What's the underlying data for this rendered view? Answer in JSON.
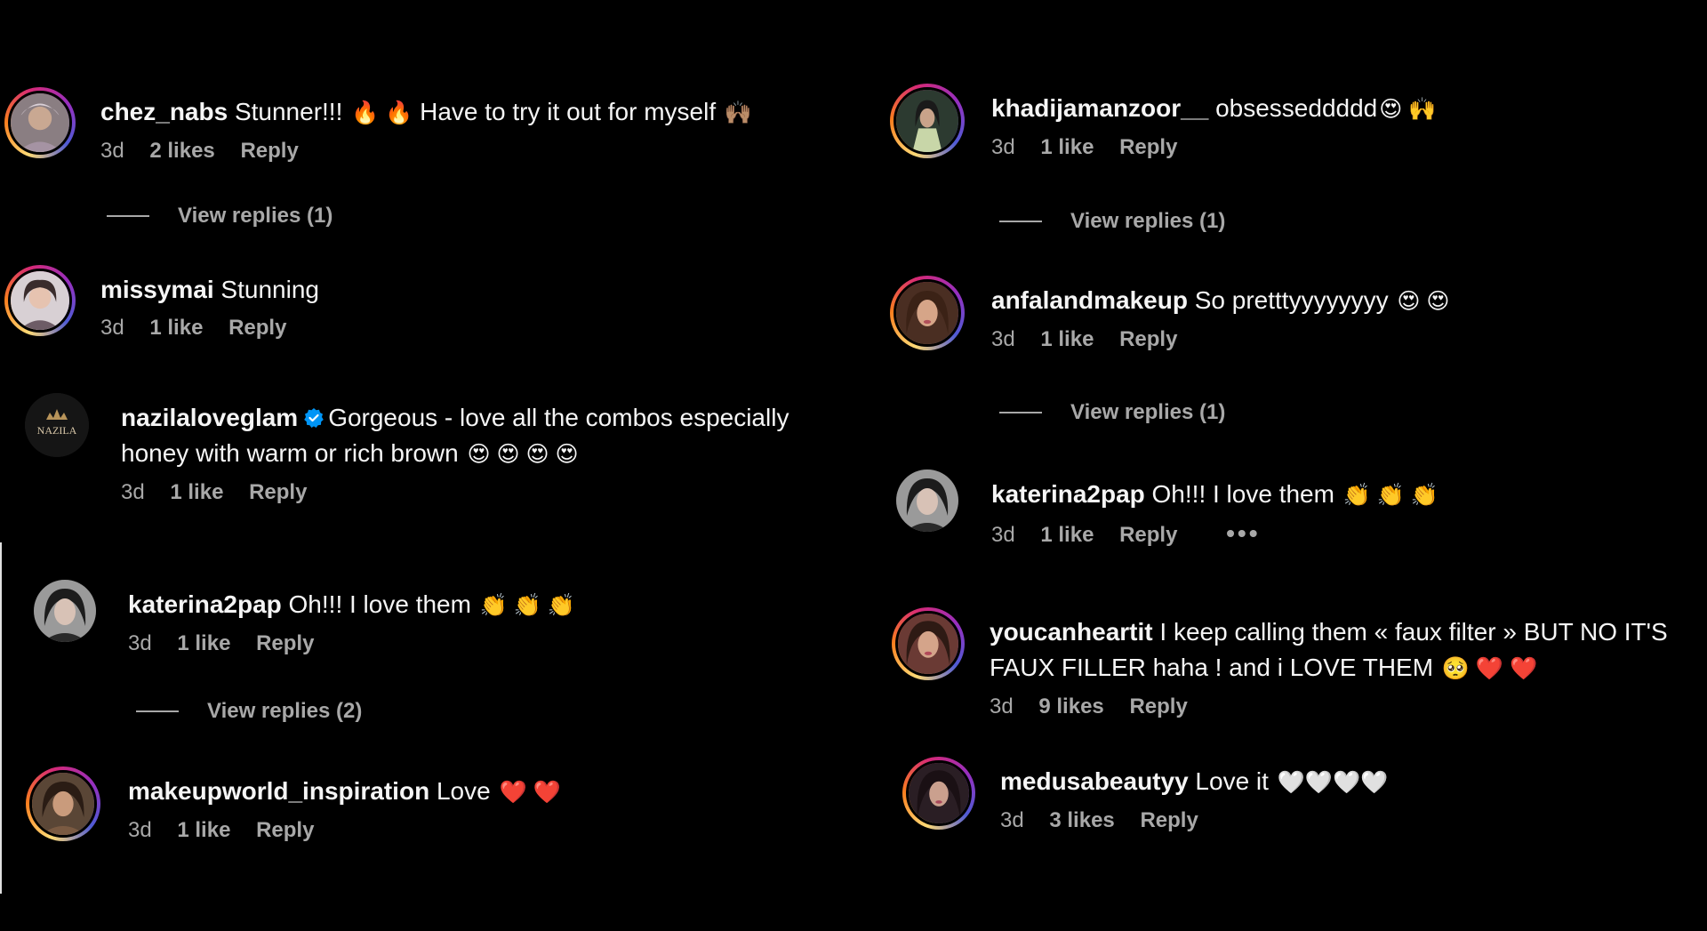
{
  "comments": [
    {
      "username": "chez_nabs",
      "text": "Stunner!!!",
      "emoji_a": "🔥 🔥",
      "text2": " Have to try it out for myself ",
      "emoji_b": "🙌🏽",
      "age": "3d",
      "likes": "2 likes",
      "reply": "Reply",
      "view_replies": "View replies (1)"
    },
    {
      "username": "missymai",
      "text": "Stunning",
      "age": "3d",
      "likes": "1 like",
      "reply": "Reply"
    },
    {
      "username": "nazilaloveglam",
      "avatar_text": "NAZILA",
      "text": "Gorgeous - love all the combos especially",
      "text_line2": "honey with warm or rich brown ",
      "emoji": "😍 😍 😍 😍",
      "age": "3d",
      "likes": "1 like",
      "reply": "Reply"
    },
    {
      "username": "katerina2pap",
      "text": "Oh!!! I love them ",
      "emoji": "👏 👏 👏",
      "age": "3d",
      "likes": "1 like",
      "reply": "Reply",
      "view_replies": "View replies (2)"
    },
    {
      "username": "makeupworld_inspiration",
      "text": "Love ",
      "emoji": "❤️ ❤️",
      "age": "3d",
      "likes": "1 like",
      "reply": "Reply"
    },
    {
      "username": "khadijamanzoor__",
      "text": "obsesseddddd",
      "emoji": "😍 🙌",
      "age": "3d",
      "likes": "1 like",
      "reply": "Reply",
      "view_replies": "View replies (1)"
    },
    {
      "username": "anfalandmakeup",
      "text": "So pretttyyyyyyyy ",
      "emoji": "😍 😍",
      "age": "3d",
      "likes": "1 like",
      "reply": "Reply",
      "view_replies": "View replies (1)"
    },
    {
      "username": "katerina2pap",
      "text": "Oh!!! I love them ",
      "emoji": "👏 👏 👏",
      "age": "3d",
      "likes": "1 like",
      "reply": "Reply",
      "more": "•••"
    },
    {
      "username": "youcanheartit",
      "text": "I keep calling them « faux filter » BUT NO IT'S",
      "text_line2": "FAUX FILLER haha ! and i LOVE THEM ",
      "emoji": "🥺 ❤️ ❤️",
      "age": "3d",
      "likes": "9 likes",
      "reply": "Reply"
    },
    {
      "username": "medusabeautyy",
      "text": "Love it ",
      "emoji": "🤍🤍🤍🤍",
      "age": "3d",
      "likes": "3 likes",
      "reply": "Reply"
    }
  ],
  "colors": {
    "background": "#000000",
    "text": "#f5f5f5",
    "muted": "#a8a8a8",
    "verified": "#0095f6"
  }
}
